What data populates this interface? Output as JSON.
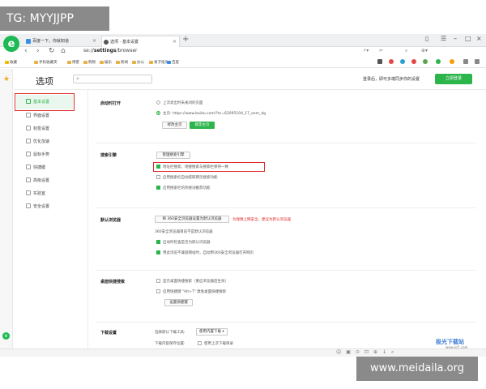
{
  "overlay": {
    "tg_label": "TG: MYYJJPP",
    "watermark_text": "www.meidaila.org"
  },
  "tabs": [
    {
      "label": "百度一下，你就知道"
    },
    {
      "label": "选项 - 基本设置"
    }
  ],
  "new_tab_symbol": "+",
  "address": {
    "scheme": "se://",
    "host": "settings",
    "path": "/browser"
  },
  "bookmarks": [
    "收藏",
    "手机收藏夹",
    "博客",
    "购物",
    "娱乐",
    "新闻",
    "办公",
    "易子指尖",
    "百度"
  ],
  "header": {
    "title": "选项",
    "search_placeholder": "",
    "login_hint": "登录后，即可多端同步你的设置",
    "login_button": "立即登录"
  },
  "nav": {
    "items": [
      {
        "label": "基本设置",
        "active": true
      },
      {
        "label": "界面设置",
        "active": false
      },
      {
        "label": "标签设置",
        "active": false
      },
      {
        "label": "优化加速",
        "active": false
      },
      {
        "label": "鼠标手势",
        "active": false
      },
      {
        "label": "快捷键",
        "active": false
      },
      {
        "label": "高级设置",
        "active": false
      },
      {
        "label": "实验室",
        "active": false
      },
      {
        "label": "安全设置",
        "active": false
      }
    ]
  },
  "sections": {
    "startup": {
      "label": "启动时打开",
      "option1": "上次退出时未关闭的页面",
      "option2": "主页: https://www.baidu.com/?tn=62095104_17_oem_dg",
      "btn_modify": "修改主页",
      "btn_lock": "锁定主页"
    },
    "search": {
      "label": "搜索引擎",
      "btn_manage": "管理搜索引擎",
      "opt1": "地址栏搜索，地搜搜索与搜索栏保持一致",
      "opt2": "启用搜索栏自动提取网页搜索功能",
      "opt3": "启用搜索栏的热搜词推荐功能"
    },
    "default_browser": {
      "label": "默认浏览器",
      "btn_set": "将 360安全浏览器设置为默认浏览器",
      "warning": "为保障上网安全，建议为默认浏览器",
      "status": "360安全浏览器目前不是默认浏览器",
      "opt1": "启动时检查是否为默认浏览器",
      "opt2": "用此浏览不兼容网站时，自动用360安全浏览器打开网页"
    },
    "desktop_search": {
      "label": "桌面快捷搜索",
      "opt1": "显示桌面快捷搜索（重启浏览器后生效）",
      "opt2": "启用快捷键 \"Alt+T\" 激发桌面快捷搜索",
      "btn": "设置快捷键"
    },
    "download": {
      "label": "下载设置",
      "tool_label": "选择默认下载工具:",
      "tool_value": "使用内置下载",
      "path_label": "下载内容保存位置:",
      "path_opt": "使用上次下载目录"
    }
  },
  "footer_watermark": {
    "logo": "极光下载站",
    "sub": "www.xz7.com"
  }
}
